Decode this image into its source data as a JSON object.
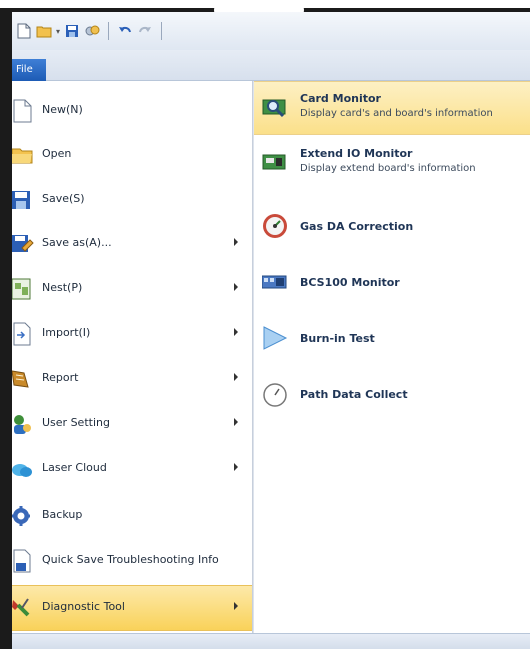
{
  "file_tab": "File",
  "menu": {
    "items": [
      {
        "label": "New(N)",
        "icon": "new-page-icon",
        "has_submenu": false
      },
      {
        "label": "Open",
        "icon": "folder-open-icon",
        "has_submenu": false
      },
      {
        "label": "Save(S)",
        "icon": "save-disk-icon",
        "has_submenu": false
      },
      {
        "label": "Save as(A)...",
        "icon": "save-as-icon",
        "has_submenu": true
      },
      {
        "label": "Nest(P)",
        "icon": "nest-icon",
        "has_submenu": true
      },
      {
        "label": "Import(I)",
        "icon": "import-icon",
        "has_submenu": true
      },
      {
        "label": "Report",
        "icon": "report-icon",
        "has_submenu": true
      },
      {
        "label": "User Setting",
        "icon": "user-setting-icon",
        "has_submenu": true
      },
      {
        "label": "Laser Cloud",
        "icon": "cloud-icon",
        "has_submenu": true
      },
      {
        "label": "Backup",
        "icon": "backup-gear-icon",
        "has_submenu": false
      },
      {
        "label": "Quick Save Troubleshooting Info",
        "icon": "troubleshoot-save-icon",
        "has_submenu": false
      },
      {
        "label": "Diagnostic Tool",
        "icon": "diagnostic-tool-icon",
        "has_submenu": true,
        "active": true
      }
    ]
  },
  "submenu": {
    "items": [
      {
        "title": "Card Monitor",
        "desc": "Display card's and board's information",
        "icon": "card-monitor-icon",
        "active": true
      },
      {
        "title": "Extend IO Monitor",
        "desc": "Display extend board's information",
        "icon": "extend-io-board-icon"
      },
      {
        "title": "Gas DA Correction",
        "desc": "",
        "icon": "gauge-icon"
      },
      {
        "title": "BCS100 Monitor",
        "desc": "",
        "icon": "bcs100-device-icon"
      },
      {
        "title": "Burn-in Test",
        "desc": "",
        "icon": "play-triangle-icon"
      },
      {
        "title": "Path Data Collect",
        "desc": "",
        "icon": "stopwatch-icon"
      }
    ]
  },
  "colors": {
    "active_highlight": "#f9d25a",
    "file_tab": "#1d5bb5",
    "frame": "#1b1b1b"
  }
}
